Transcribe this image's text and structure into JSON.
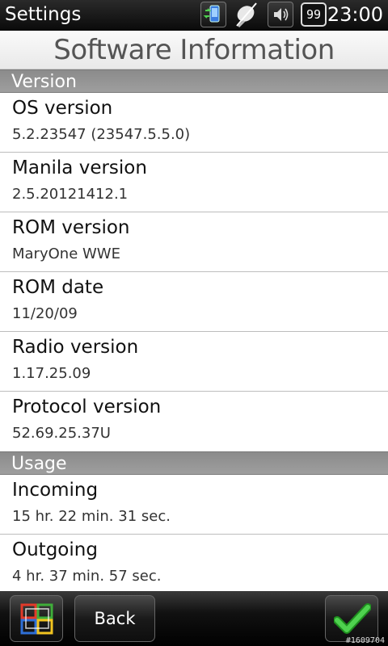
{
  "status_bar": {
    "app_title": "Settings",
    "time": "23:00",
    "battery_level": "99",
    "icons": [
      "connection-icon",
      "signal-off-icon",
      "volume-icon",
      "battery-icon"
    ]
  },
  "page": {
    "title": "Software Information"
  },
  "sections": {
    "version": {
      "header": "Version",
      "items": [
        {
          "label": "OS version",
          "value": "5.2.23547 (23547.5.5.0)"
        },
        {
          "label": "Manila version",
          "value": "2.5.20121412.1"
        },
        {
          "label": "ROM version",
          "value": "MaryOne WWE"
        },
        {
          "label": "ROM date",
          "value": "11/20/09"
        },
        {
          "label": "Radio version",
          "value": "1.17.25.09"
        },
        {
          "label": "Protocol version",
          "value": "52.69.25.37U"
        }
      ]
    },
    "usage": {
      "header": "Usage",
      "items": [
        {
          "label": "Incoming",
          "value": "15 hr. 22 min. 31 sec."
        },
        {
          "label": "Outgoing",
          "value": "4 hr. 37 min. 57 sec."
        }
      ]
    }
  },
  "bottom_bar": {
    "start_icon": "windows-start-icon",
    "back_label": "Back",
    "ok_icon": "checkmark-icon",
    "watermark": "#1609704"
  },
  "colors": {
    "section_header": "#939393",
    "checkmark": "#2fb52f",
    "background": "#ffffff"
  }
}
